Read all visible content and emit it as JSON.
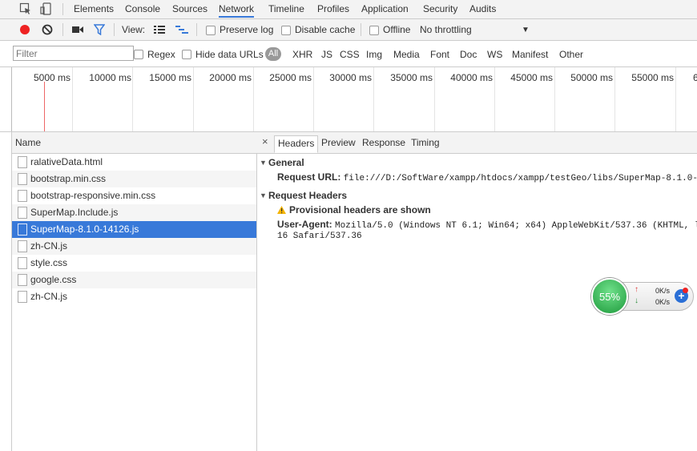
{
  "tabs": [
    "Elements",
    "Console",
    "Sources",
    "Network",
    "Timeline",
    "Profiles",
    "Application",
    "Security",
    "Audits"
  ],
  "active_tab": "Network",
  "toolbar": {
    "view_label": "View:",
    "preserve_log": "Preserve log",
    "disable_cache": "Disable cache",
    "offline": "Offline",
    "throttling": "No throttling",
    "dropdown_arrow": "▼"
  },
  "filter": {
    "placeholder": "Filter",
    "regex": "Regex",
    "hide_data_urls": "Hide data URLs",
    "all": "All",
    "types": [
      "XHR",
      "JS",
      "CSS",
      "Img",
      "Media",
      "Font",
      "Doc",
      "WS",
      "Manifest",
      "Other"
    ]
  },
  "timeline": {
    "ticks": [
      "5000 ms",
      "10000 ms",
      "15000 ms",
      "20000 ms",
      "25000 ms",
      "30000 ms",
      "35000 ms",
      "40000 ms",
      "45000 ms",
      "50000 ms",
      "55000 ms",
      "6"
    ]
  },
  "list": {
    "header": "Name",
    "requests": [
      "ralativeData.html",
      "bootstrap.min.css",
      "bootstrap-responsive.min.css",
      "SuperMap.Include.js",
      "SuperMap-8.1.0-14126.js",
      "zh-CN.js",
      "style.css",
      "google.css",
      "zh-CN.js"
    ],
    "selected_index": 4
  },
  "detail": {
    "close": "×",
    "tabs": [
      "Headers",
      "Preview",
      "Response",
      "Timing"
    ],
    "general_title": "General",
    "request_url_key": "Request URL:",
    "request_url_value": "file:///D:/SoftWare/xampp/htdocs/xampp/testGeo/libs/SuperMap-8.1.0-",
    "request_headers_title": "Request Headers",
    "provisional": "Provisional headers are shown",
    "ua_key": "User-Agent:",
    "ua_value_line1": "Mozilla/5.0 (Windows NT 6.1; Win64; x64) AppleWebKit/537.36 (KHTML, l",
    "ua_value_line2": "16 Safari/537.36"
  },
  "speed_widget": {
    "percent": "55%",
    "up": "0K/s",
    "down": "0K/s",
    "plus": "+"
  },
  "colors": {
    "accent": "#3879d9",
    "record": "#e22",
    "warning": "#f5b400",
    "speed_green": "#1e9a3c"
  }
}
